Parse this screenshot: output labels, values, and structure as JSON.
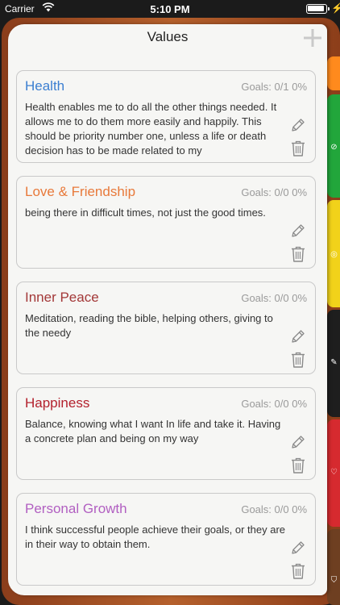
{
  "status_bar": {
    "carrier": "Carrier",
    "time": "5:10 PM"
  },
  "header": {
    "title": "Values",
    "add_icon": "plus-icon"
  },
  "tabs": [
    {
      "color": "#ff8a1d",
      "icon": ""
    },
    {
      "color": "#22a63b",
      "icon": "compass-icon"
    },
    {
      "color": "#f1d21a",
      "icon": "target-icon"
    },
    {
      "color": "#1e1e1e",
      "icon": "feather-icon"
    },
    {
      "color": "#d62a2f",
      "icon": "heart-icon"
    },
    {
      "color": "#6e3f21",
      "icon": "shield-icon"
    }
  ],
  "values": [
    {
      "title": "Health",
      "color": "#3c7fd1",
      "goals": "Goals: 0/1 0%",
      "description": "Health enables me to do all the other things needed. It allows me to do them more easily and happily. This should be priority number one, unless a life or death decision has to be made related to my"
    },
    {
      "title": "Love & Friendship",
      "color": "#e8793a",
      "goals": "Goals: 0/0 0%",
      "description": "being there in difficult times, not just the good times."
    },
    {
      "title": "Inner Peace",
      "color": "#a33838",
      "goals": "Goals: 0/0 0%",
      "description": "Meditation, reading the bible, helping others, giving to the needy"
    },
    {
      "title": "Happiness",
      "color": "#b3212d",
      "goals": "Goals: 0/0 0%",
      "description": "Balance, knowing what I want In life and take it. Having a concrete plan and being on my way"
    },
    {
      "title": "Personal Growth",
      "color": "#b15fc1",
      "goals": "Goals: 0/0 0%",
      "description": "I think successful people achieve their goals, or they are in their way to obtain them."
    }
  ]
}
